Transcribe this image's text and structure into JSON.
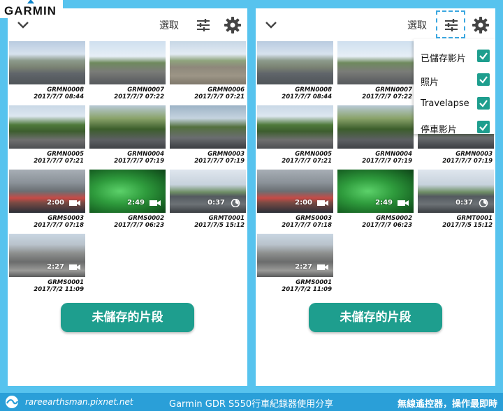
{
  "brand": {
    "logo": "GARMIN",
    "accent": "#1e9e8e"
  },
  "toolbar": {
    "select_label": "選取",
    "filter_icon": "sliders-icon",
    "settings_icon": "gear-icon",
    "back_icon": "chevron-down-icon"
  },
  "gallery": {
    "items": [
      {
        "name": "GRMN0008",
        "date": "2017/7/7 08:44",
        "duration": "",
        "kind": "photo",
        "thumb": "th-street"
      },
      {
        "name": "GRMN0007",
        "date": "2017/7/7 07:22",
        "duration": "",
        "kind": "photo",
        "thumb": "th-street2"
      },
      {
        "name": "GRMN0006",
        "date": "2017/7/7 07:21",
        "duration": "",
        "kind": "photo",
        "thumb": "th-plaza"
      },
      {
        "name": "GRMN0005",
        "date": "2017/7/7 07:21",
        "duration": "",
        "kind": "photo",
        "thumb": "th-trees"
      },
      {
        "name": "GRMN0004",
        "date": "2017/7/7 07:19",
        "duration": "",
        "kind": "photo",
        "thumb": "th-trees2"
      },
      {
        "name": "GRMN0003",
        "date": "2017/7/7 07:19",
        "duration": "",
        "kind": "photo",
        "thumb": "th-red"
      },
      {
        "name": "GRMS0003",
        "date": "2017/7/7 07:18",
        "duration": "2:00",
        "kind": "video",
        "thumb": "th-dash"
      },
      {
        "name": "GRMS0002",
        "date": "2017/7/7 06:23",
        "duration": "2:49",
        "kind": "video",
        "thumb": "th-green"
      },
      {
        "name": "GRMT0001",
        "date": "2017/7/5 15:12",
        "duration": "0:37",
        "kind": "travelapse",
        "thumb": "th-road"
      },
      {
        "name": "GRMS0001",
        "date": "2017/7/2 11:09",
        "duration": "2:27",
        "kind": "video",
        "thumb": "th-city"
      }
    ]
  },
  "unsaved_button": "未儲存的片段",
  "filter_menu": {
    "items": [
      {
        "label": "已儲存影片",
        "checked": true
      },
      {
        "label": "照片",
        "checked": true
      },
      {
        "label": "Travelapse",
        "checked": true
      },
      {
        "label": "停車影片",
        "checked": true
      }
    ]
  },
  "footer": {
    "site": "rareearthsman.pixnet.net",
    "title": "Garmin GDR S550行車紀錄器使用分享",
    "right": "無線遙控器，操作最即時"
  }
}
